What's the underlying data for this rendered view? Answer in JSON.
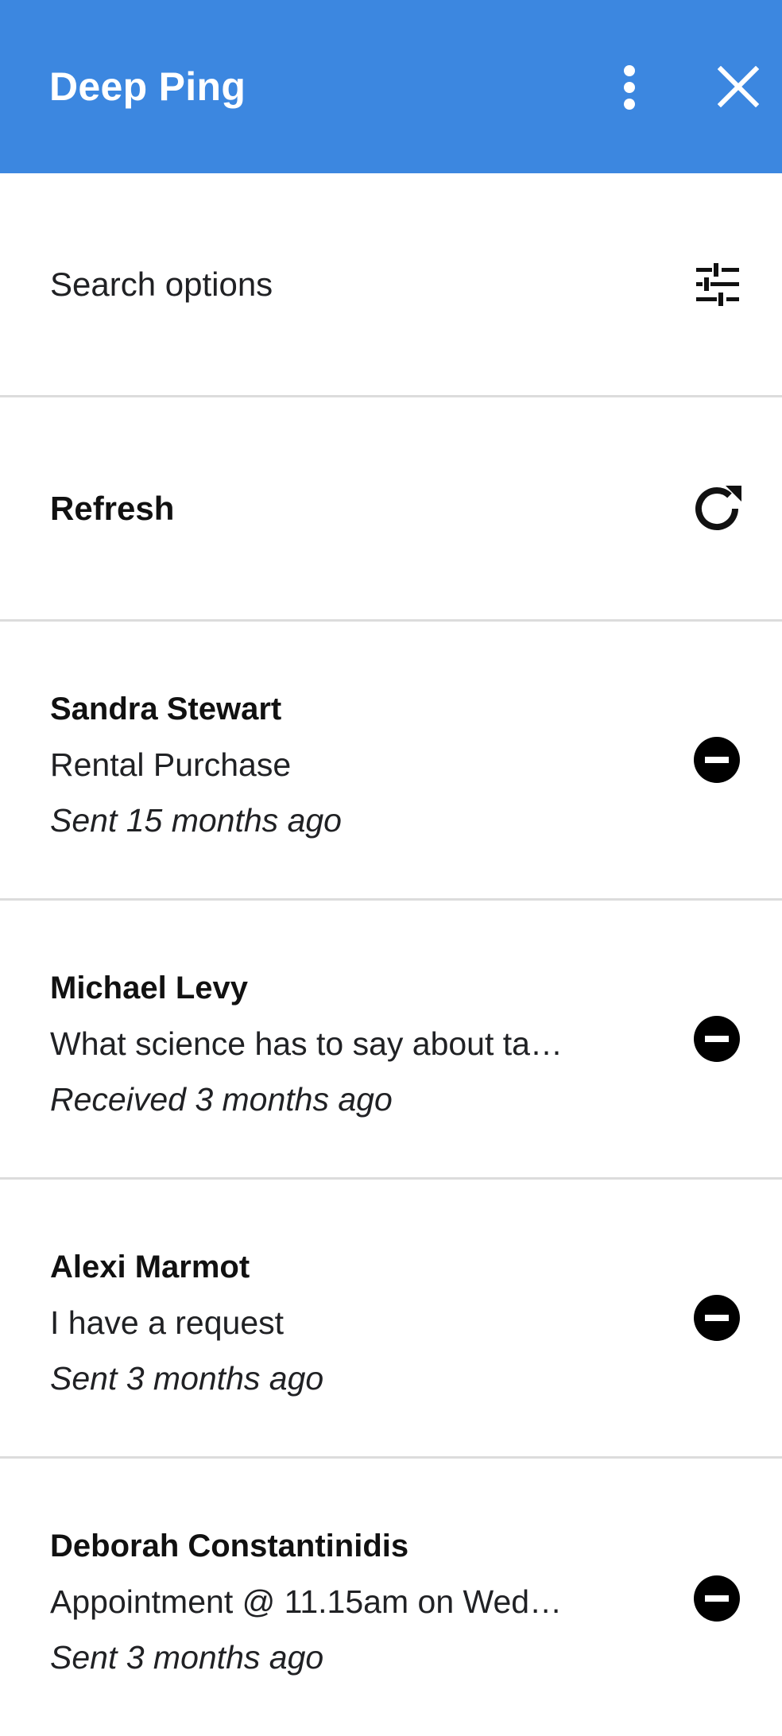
{
  "header": {
    "title": "Deep Ping",
    "background_color": "#3c87e0",
    "more_icon": "more-vert-icon",
    "close_icon": "close-icon"
  },
  "search": {
    "label": "Search options",
    "icon": "tune-icon"
  },
  "refresh": {
    "label": "Refresh",
    "icon": "refresh-icon"
  },
  "messages": [
    {
      "name": "Sandra Stewart",
      "subject": "Rental Purchase",
      "time": "Sent 15 months ago",
      "action_icon": "remove-circle-icon"
    },
    {
      "name": "Michael Levy",
      "subject": "What science has to say about ta…",
      "time": "Received 3 months ago",
      "action_icon": "remove-circle-icon"
    },
    {
      "name": "Alexi Marmot",
      "subject": "I have a request",
      "time": "Sent 3 months ago",
      "action_icon": "remove-circle-icon"
    },
    {
      "name": "Deborah Constantinidis",
      "subject": "Appointment @ 11.15am on Wed…",
      "time": "Sent 3 months ago",
      "action_icon": "remove-circle-icon"
    }
  ]
}
